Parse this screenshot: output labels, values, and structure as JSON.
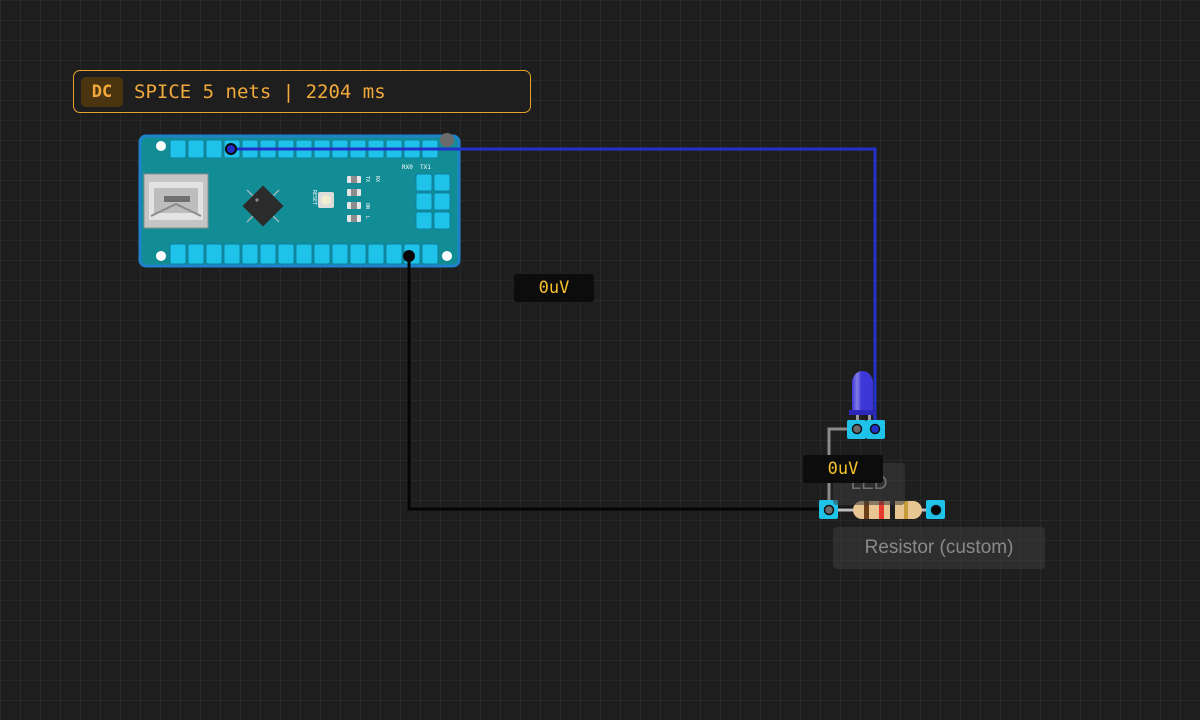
{
  "simulation": {
    "mode_badge": "DC",
    "status_text": "SPICE 5 nets | 2204 ms"
  },
  "probes": [
    {
      "value": "0uV"
    },
    {
      "value": "0uV"
    }
  ],
  "components": {
    "board": {
      "labels": {
        "rx0": "RX0",
        "tx1": "TX1",
        "reset": "RESET",
        "tx": "TX",
        "rx": "RX",
        "on": "ON",
        "l": "L"
      }
    },
    "led": {
      "label": "LED"
    },
    "resistor": {
      "label": "Resistor (custom)"
    }
  },
  "wires": [
    {
      "name": "blue-wire",
      "color": "#2231c9"
    },
    {
      "name": "black-wire",
      "color": "#050505"
    },
    {
      "name": "gray-wire",
      "color": "#8b8b8b"
    }
  ],
  "colors": {
    "board": "#128d96",
    "board_border": "#1e82cc",
    "pin_pad": "#1fc3ea",
    "accent": "#e9a229",
    "probe_text": "#f5c12d",
    "led_body": "#3d37d8"
  }
}
